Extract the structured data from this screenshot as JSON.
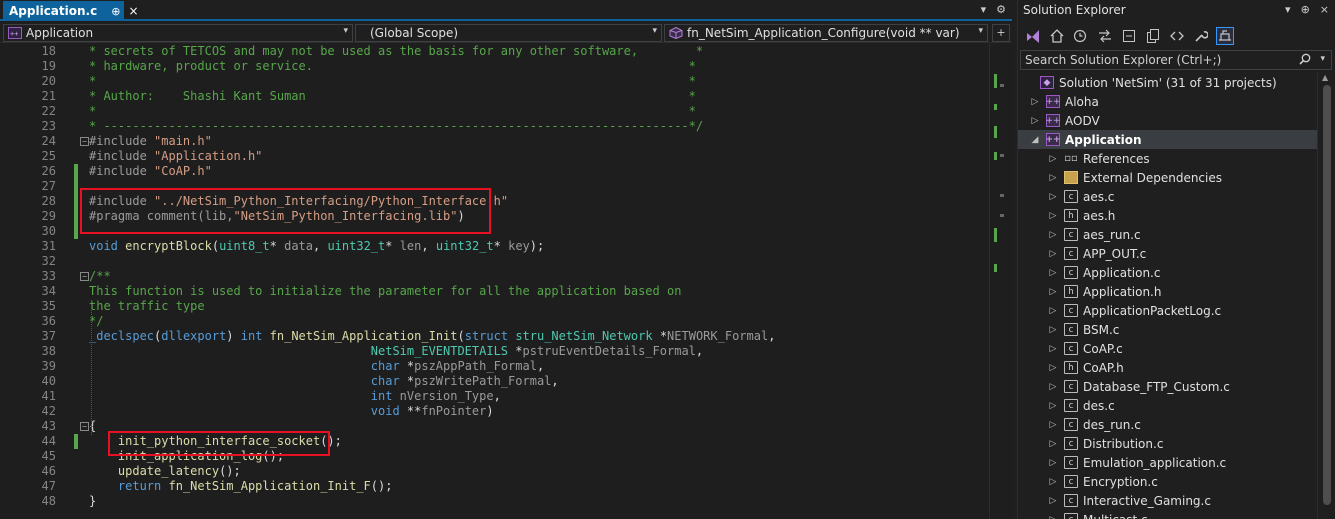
{
  "editor": {
    "tab": {
      "title": "Application.c",
      "pin": "⊕",
      "close": "×"
    },
    "tab_icons": [
      "▾",
      "⚙"
    ],
    "nav": {
      "project": "Application",
      "scope": "(Global Scope)",
      "member": "fn_NetSim_Application_Configure(void ** var)"
    },
    "lines": [
      {
        "n": "18",
        "spans": [
          {
            "c": "com",
            "t": "* secrets of TETCOS and may not be used as the basis for any other software,        *"
          }
        ]
      },
      {
        "n": "19",
        "spans": [
          {
            "c": "com",
            "t": "* hardware, product or service.                                                    *"
          }
        ]
      },
      {
        "n": "20",
        "spans": [
          {
            "c": "com",
            "t": "*                                                                                  *"
          }
        ]
      },
      {
        "n": "21",
        "spans": [
          {
            "c": "com",
            "t": "* Author:    Shashi Kant Suman                                                     *"
          }
        ]
      },
      {
        "n": "22",
        "spans": [
          {
            "c": "com",
            "t": "*                                                                                  *"
          }
        ]
      },
      {
        "n": "23",
        "spans": [
          {
            "c": "com",
            "t": "* ---------------------------------------------------------------------------------*/"
          }
        ]
      },
      {
        "n": "24",
        "spans": [
          {
            "c": "pp",
            "t": "#include "
          },
          {
            "c": "str",
            "t": "\"main.h\""
          }
        ]
      },
      {
        "n": "25",
        "spans": [
          {
            "c": "pp",
            "t": "#include "
          },
          {
            "c": "str",
            "t": "\"Application.h\""
          }
        ]
      },
      {
        "n": "26",
        "spans": [
          {
            "c": "pp",
            "t": "#include "
          },
          {
            "c": "str",
            "t": "\"CoAP.h\""
          }
        ]
      },
      {
        "n": "27",
        "spans": []
      },
      {
        "n": "28",
        "spans": [
          {
            "c": "pp",
            "t": "#include "
          },
          {
            "c": "str",
            "t": "\"../NetSim_Python_Interfacing/Python_Interface.h\""
          }
        ]
      },
      {
        "n": "29",
        "spans": [
          {
            "c": "pp",
            "t": "#pragma comment(lib,"
          },
          {
            "c": "str",
            "t": "\"NetSim_Python_Interfacing.lib\""
          },
          {
            "c": "pl",
            "t": ")"
          }
        ]
      },
      {
        "n": "30",
        "spans": []
      },
      {
        "n": "31",
        "spans": [
          {
            "c": "kw",
            "t": "void "
          },
          {
            "c": "fn",
            "t": "encryptBlock"
          },
          {
            "c": "pl",
            "t": "("
          },
          {
            "c": "ty",
            "t": "uint8_t"
          },
          {
            "c": "pl",
            "t": "* "
          },
          {
            "c": "par",
            "t": "data"
          },
          {
            "c": "pl",
            "t": ", "
          },
          {
            "c": "ty",
            "t": "uint32_t"
          },
          {
            "c": "pl",
            "t": "* "
          },
          {
            "c": "par",
            "t": "len"
          },
          {
            "c": "pl",
            "t": ", "
          },
          {
            "c": "ty",
            "t": "uint32_t"
          },
          {
            "c": "pl",
            "t": "* "
          },
          {
            "c": "par",
            "t": "key"
          },
          {
            "c": "pl",
            "t": ");"
          }
        ]
      },
      {
        "n": "32",
        "spans": []
      },
      {
        "n": "33",
        "spans": [
          {
            "c": "com",
            "t": "/**"
          }
        ]
      },
      {
        "n": "34",
        "spans": [
          {
            "c": "com",
            "t": "This function is used to initialize the parameter for all the application based on"
          }
        ]
      },
      {
        "n": "35",
        "spans": [
          {
            "c": "com",
            "t": "the traffic type"
          }
        ]
      },
      {
        "n": "36",
        "spans": [
          {
            "c": "com",
            "t": "*/"
          }
        ]
      },
      {
        "n": "37",
        "spans": [
          {
            "c": "kw",
            "t": "_declspec"
          },
          {
            "c": "pl",
            "t": "("
          },
          {
            "c": "kw",
            "t": "dllexport"
          },
          {
            "c": "pl",
            "t": ") "
          },
          {
            "c": "kw",
            "t": "int "
          },
          {
            "c": "fn",
            "t": "fn_NetSim_Application_Init"
          },
          {
            "c": "pl",
            "t": "("
          },
          {
            "c": "kw",
            "t": "struct "
          },
          {
            "c": "ty",
            "t": "stru_NetSim_Network"
          },
          {
            "c": "pl",
            "t": " *"
          },
          {
            "c": "par",
            "t": "NETWORK_Formal"
          },
          {
            "c": "pl",
            "t": ","
          }
        ]
      },
      {
        "n": "38",
        "spans": [
          {
            "c": "pl",
            "t": "                                       "
          },
          {
            "c": "ty",
            "t": "NetSim_EVENTDETAILS"
          },
          {
            "c": "pl",
            "t": " *"
          },
          {
            "c": "par",
            "t": "pstruEventDetails_Formal"
          },
          {
            "c": "pl",
            "t": ","
          }
        ]
      },
      {
        "n": "39",
        "spans": [
          {
            "c": "pl",
            "t": "                                       "
          },
          {
            "c": "kw",
            "t": "char"
          },
          {
            "c": "pl",
            "t": " *"
          },
          {
            "c": "par",
            "t": "pszAppPath_Formal"
          },
          {
            "c": "pl",
            "t": ","
          }
        ]
      },
      {
        "n": "40",
        "spans": [
          {
            "c": "pl",
            "t": "                                       "
          },
          {
            "c": "kw",
            "t": "char"
          },
          {
            "c": "pl",
            "t": " *"
          },
          {
            "c": "par",
            "t": "pszWritePath_Formal"
          },
          {
            "c": "pl",
            "t": ","
          }
        ]
      },
      {
        "n": "41",
        "spans": [
          {
            "c": "pl",
            "t": "                                       "
          },
          {
            "c": "kw",
            "t": "int "
          },
          {
            "c": "par",
            "t": "nVersion_Type"
          },
          {
            "c": "pl",
            "t": ","
          }
        ]
      },
      {
        "n": "42",
        "spans": [
          {
            "c": "pl",
            "t": "                                       "
          },
          {
            "c": "kw",
            "t": "void"
          },
          {
            "c": "pl",
            "t": " **"
          },
          {
            "c": "par",
            "t": "fnPointer"
          },
          {
            "c": "pl",
            "t": ")"
          }
        ]
      },
      {
        "n": "43",
        "spans": [
          {
            "c": "pl",
            "t": "{"
          }
        ]
      },
      {
        "n": "44",
        "spans": [
          {
            "c": "pl",
            "t": "    "
          },
          {
            "c": "fn",
            "t": "init_python_interface_socket"
          },
          {
            "c": "pl",
            "t": "();"
          }
        ]
      },
      {
        "n": "45",
        "spans": [
          {
            "c": "pl",
            "t": "    "
          },
          {
            "c": "fn",
            "t": "init_application_log"
          },
          {
            "c": "pl",
            "t": "();"
          }
        ]
      },
      {
        "n": "46",
        "spans": [
          {
            "c": "pl",
            "t": "    "
          },
          {
            "c": "fn",
            "t": "update_latency"
          },
          {
            "c": "pl",
            "t": "();"
          }
        ]
      },
      {
        "n": "47",
        "spans": [
          {
            "c": "pl",
            "t": "    "
          },
          {
            "c": "kw",
            "t": "return "
          },
          {
            "c": "fn",
            "t": "fn_NetSim_Application_Init_F"
          },
          {
            "c": "pl",
            "t": "();"
          }
        ]
      },
      {
        "n": "48",
        "spans": [
          {
            "c": "pl",
            "t": "}"
          }
        ]
      }
    ]
  },
  "solution_explorer": {
    "title": "Solution Explorer",
    "title_icons": [
      "▾",
      "⊕",
      "×"
    ],
    "search_placeholder": "Search Solution Explorer (Ctrl+;)",
    "tree": [
      {
        "label": "Solution 'NetSim' (31 of 31 projects)",
        "indent": 0,
        "exp": "",
        "icon": "sln",
        "glyph": "◆"
      },
      {
        "label": "Aloha",
        "indent": 1,
        "exp": "▷",
        "icon": "proj",
        "glyph": "++"
      },
      {
        "label": "AODV",
        "indent": 1,
        "exp": "▷",
        "icon": "proj",
        "glyph": "++"
      },
      {
        "label": "Application",
        "indent": 1,
        "exp": "◢",
        "icon": "proj",
        "glyph": "++",
        "selected": true
      },
      {
        "label": "References",
        "indent": 2,
        "exp": "▷",
        "icon": "ref",
        "glyph": "▫▫"
      },
      {
        "label": "External Dependencies",
        "indent": 2,
        "exp": "▷",
        "icon": "dep",
        "glyph": ""
      },
      {
        "label": "aes.c",
        "indent": 2,
        "exp": "▷",
        "icon": "file",
        "glyph": "c"
      },
      {
        "label": "aes.h",
        "indent": 2,
        "exp": "▷",
        "icon": "file",
        "glyph": "h"
      },
      {
        "label": "aes_run.c",
        "indent": 2,
        "exp": "▷",
        "icon": "file",
        "glyph": "c"
      },
      {
        "label": "APP_OUT.c",
        "indent": 2,
        "exp": "▷",
        "icon": "file",
        "glyph": "c"
      },
      {
        "label": "Application.c",
        "indent": 2,
        "exp": "▷",
        "icon": "file",
        "glyph": "c"
      },
      {
        "label": "Application.h",
        "indent": 2,
        "exp": "▷",
        "icon": "file",
        "glyph": "h"
      },
      {
        "label": "ApplicationPacketLog.c",
        "indent": 2,
        "exp": "▷",
        "icon": "file",
        "glyph": "c"
      },
      {
        "label": "BSM.c",
        "indent": 2,
        "exp": "▷",
        "icon": "file",
        "glyph": "c"
      },
      {
        "label": "CoAP.c",
        "indent": 2,
        "exp": "▷",
        "icon": "file",
        "glyph": "c"
      },
      {
        "label": "CoAP.h",
        "indent": 2,
        "exp": "▷",
        "icon": "file",
        "glyph": "h"
      },
      {
        "label": "Database_FTP_Custom.c",
        "indent": 2,
        "exp": "▷",
        "icon": "file",
        "glyph": "c"
      },
      {
        "label": "des.c",
        "indent": 2,
        "exp": "▷",
        "icon": "file",
        "glyph": "c"
      },
      {
        "label": "des_run.c",
        "indent": 2,
        "exp": "▷",
        "icon": "file",
        "glyph": "c"
      },
      {
        "label": "Distribution.c",
        "indent": 2,
        "exp": "▷",
        "icon": "file",
        "glyph": "c"
      },
      {
        "label": "Emulation_application.c",
        "indent": 2,
        "exp": "▷",
        "icon": "file",
        "glyph": "c"
      },
      {
        "label": "Encryption.c",
        "indent": 2,
        "exp": "▷",
        "icon": "file",
        "glyph": "c"
      },
      {
        "label": "Interactive_Gaming.c",
        "indent": 2,
        "exp": "▷",
        "icon": "file",
        "glyph": "c"
      },
      {
        "label": "Multicast.c",
        "indent": 2,
        "exp": "▷",
        "icon": "file",
        "glyph": "c"
      }
    ]
  },
  "colors": {
    "accent": "#0e639c",
    "highlight_box": "#e81123",
    "change_bar": "#57a64a"
  }
}
